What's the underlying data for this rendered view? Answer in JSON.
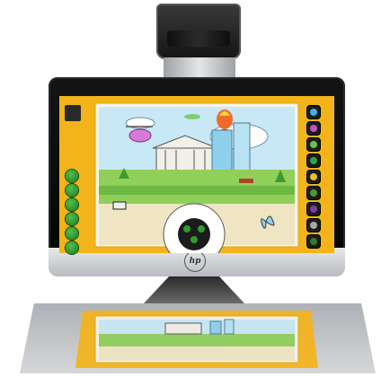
{
  "device": {
    "logo_text": "hp"
  },
  "colors": {
    "frame": "#f3b419",
    "sky": "#bfe4f5",
    "grass": "#7fc24a",
    "tool_green": "#2e9c2e"
  },
  "left_tools": [
    "pencil-icon",
    "brush-icon",
    "eraser-icon",
    "fill-icon",
    "shape-icon",
    "sticker-icon",
    "settings-icon"
  ],
  "right_tools": [
    "bird-sticker-icon",
    "flower-sticker-icon",
    "leaf-sticker-icon",
    "plant-sticker-icon",
    "star-sticker-icon",
    "tree-sticker-icon",
    "grape-sticker-icon",
    "cat-sticker-icon",
    "fruit-sticker-icon"
  ],
  "right_tool_colors": [
    "#3bb0e6",
    "#c94fc9",
    "#6ac24a",
    "#2fa34a",
    "#e8c12a",
    "#4a9a3a",
    "#7a3ea6",
    "#a8a8a8",
    "#2e7d2e"
  ]
}
